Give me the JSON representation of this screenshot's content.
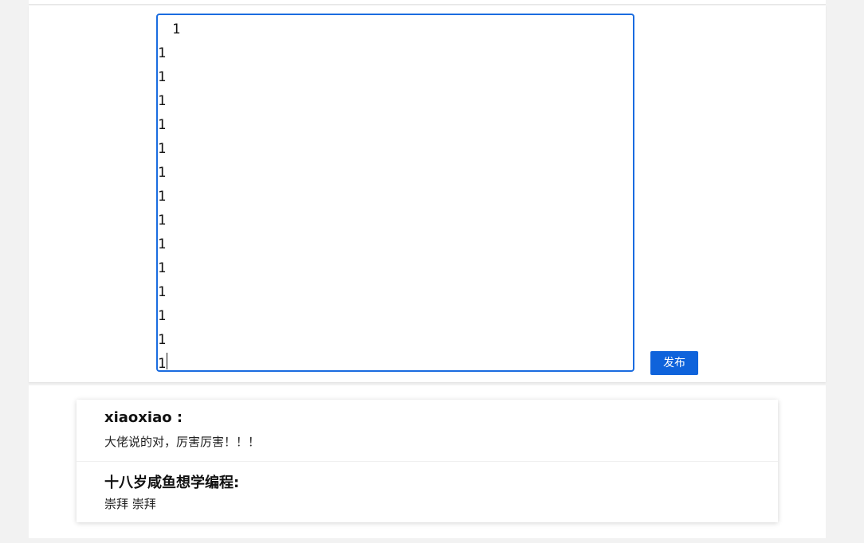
{
  "editor": {
    "lines": [
      "1",
      "1",
      "1",
      "1",
      "1",
      "1",
      "1",
      "1",
      "1",
      "1",
      "1",
      "1",
      "1",
      "1",
      "1"
    ]
  },
  "actions": {
    "publish_label": "发布"
  },
  "comments": [
    {
      "author": "xiaoxiao :",
      "text": "大佬说的对，厉害厉害！！！"
    },
    {
      "author": "十八岁咸鱼想学编程:",
      "text": "崇拜 崇拜"
    }
  ],
  "colors": {
    "accent": "#1a6ce0",
    "button": "#0f63db",
    "page_bg": "#f2f2f2"
  }
}
